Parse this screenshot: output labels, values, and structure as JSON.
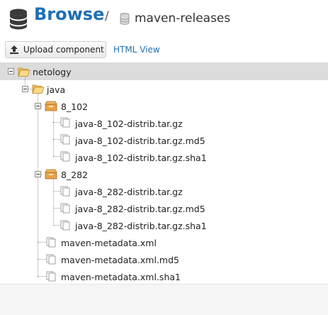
{
  "header": {
    "title": "Browse",
    "separator": "/",
    "repository": "maven-releases"
  },
  "toolbar": {
    "upload_label": "Upload component",
    "html_view_label": "HTML View"
  },
  "tree": {
    "root": "netology",
    "java": "java",
    "v102": {
      "name": "8_102",
      "files": [
        "java-8_102-distrib.tar.gz",
        "java-8_102-distrib.tar.gz.md5",
        "java-8_102-distrib.tar.gz.sha1"
      ]
    },
    "v282": {
      "name": "8_282",
      "files": [
        "java-8_282-distrib.tar.gz",
        "java-8_282-distrib.tar.gz.md5",
        "java-8_282-distrib.tar.gz.sha1"
      ]
    },
    "metadata": [
      "maven-metadata.xml",
      "maven-metadata.xml.md5",
      "maven-metadata.xml.sha1"
    ]
  },
  "colors": {
    "accent": "#1e6fb3",
    "selected_row": "#dcdcdc",
    "folder": "#f6c96a",
    "package": "#e8a24a"
  },
  "icons": {
    "header": "database-icon",
    "repo": "repository-icon",
    "upload": "upload-icon",
    "folder": "folder-open-icon",
    "package": "package-icon",
    "file": "file-icon"
  }
}
